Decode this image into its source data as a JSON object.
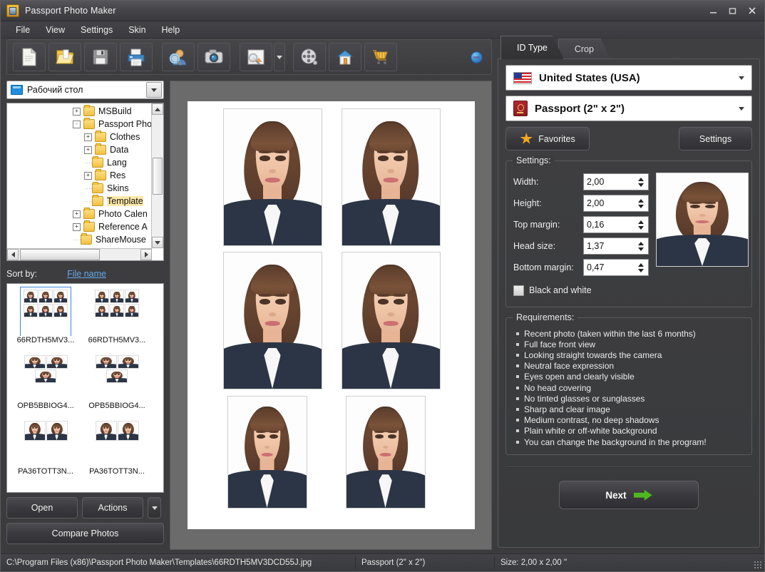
{
  "window": {
    "title": "Passport Photo Maker",
    "controls": {
      "minimize": "–",
      "maximize": "□",
      "close": "✕"
    }
  },
  "menu": {
    "items": [
      "File",
      "View",
      "Settings",
      "Skin",
      "Help"
    ]
  },
  "toolbar": {
    "buttons": [
      {
        "name": "new-document-icon",
        "tooltip": "New"
      },
      {
        "name": "open-folder-icon",
        "tooltip": "Open"
      },
      {
        "name": "save-floppy-icon",
        "tooltip": "Save"
      },
      {
        "name": "print-icon",
        "tooltip": "Print"
      },
      {
        "name": "find-person-icon",
        "tooltip": "Find person"
      },
      {
        "name": "camera-icon",
        "tooltip": "Capture from camera"
      },
      {
        "name": "image-search-icon",
        "tooltip": "Preview"
      },
      {
        "name": "film-reel-icon",
        "tooltip": "Video"
      },
      {
        "name": "home-icon",
        "tooltip": "Home page"
      },
      {
        "name": "shopping-cart-icon",
        "tooltip": "Buy now"
      }
    ],
    "extra_icon": "blue-orb-icon"
  },
  "left_panel": {
    "folder_combo": {
      "value": "Рабочий стол",
      "icon": "desktop-monitor-icon"
    },
    "tree": [
      {
        "label": "MSBuild",
        "depth": 1,
        "expander": "+",
        "selected": false
      },
      {
        "label": "Passport Pho",
        "depth": 1,
        "expander": "-",
        "selected": false
      },
      {
        "label": "Clothes",
        "depth": 2,
        "expander": "+",
        "selected": false
      },
      {
        "label": "Data",
        "depth": 2,
        "expander": "+",
        "selected": false
      },
      {
        "label": "Lang",
        "depth": 2,
        "expander": "",
        "selected": false
      },
      {
        "label": "Res",
        "depth": 2,
        "expander": "+",
        "selected": false
      },
      {
        "label": "Skins",
        "depth": 2,
        "expander": "",
        "selected": false
      },
      {
        "label": "Template",
        "depth": 2,
        "expander": "",
        "selected": true
      },
      {
        "label": "Photo Calen",
        "depth": 1,
        "expander": "+",
        "selected": false
      },
      {
        "label": "Reference A",
        "depth": 1,
        "expander": "+",
        "selected": false
      },
      {
        "label": "ShareMouse",
        "depth": 1,
        "expander": "",
        "selected": false
      }
    ],
    "sort": {
      "label": "Sort by:",
      "value": "File name"
    },
    "thumbnails": [
      {
        "name": "66RDTH5MV3...",
        "layout": "grid6",
        "selected": true
      },
      {
        "name": "66RDTH5MV3...",
        "layout": "grid6",
        "selected": false
      },
      {
        "name": "OPB5BBIOG4...",
        "layout": "strip3",
        "selected": false
      },
      {
        "name": "OPB5BBIOG4...",
        "layout": "strip3",
        "selected": false
      },
      {
        "name": "PA36TOTT3N...",
        "layout": "strip2",
        "selected": false
      },
      {
        "name": "PA36TOTT3N...",
        "layout": "strip2",
        "selected": false
      }
    ],
    "buttons": {
      "open": "Open",
      "actions": "Actions",
      "compare": "Compare Photos"
    }
  },
  "preview": {
    "photo_count": 6,
    "rows": [
      {
        "count": 2,
        "size": "large"
      },
      {
        "count": 2,
        "size": "large"
      },
      {
        "count": 2,
        "size": "small"
      }
    ]
  },
  "right_panel": {
    "tabs": [
      {
        "label": "ID Type",
        "active": true
      },
      {
        "label": "Crop",
        "active": false
      }
    ],
    "country": {
      "value": "United States (USA)",
      "icon": "usa-flag-icon"
    },
    "document_type": {
      "value": "Passport (2\" x 2\")",
      "icon": "passport-book-icon"
    },
    "favorites_button": "Favorites",
    "settings_button": "Settings",
    "settings": {
      "title": "Settings:",
      "fields": [
        {
          "label": "Width:",
          "value": "2,00"
        },
        {
          "label": "Height:",
          "value": "2,00"
        },
        {
          "label": "Top margin:",
          "value": "0,16"
        },
        {
          "label": "Head size:",
          "value": "1,37"
        },
        {
          "label": "Bottom margin:",
          "value": "0,47"
        }
      ],
      "checkbox": {
        "label": "Black and white",
        "checked": false
      }
    },
    "requirements": {
      "title": "Requirements:",
      "items": [
        "Recent photo (taken within the last 6 months)",
        "Full face front view",
        "Looking straight towards the camera",
        "Neutral face expression",
        "Eyes open and clearly visible",
        "No head covering",
        "No tinted glasses or sunglasses",
        "Sharp and clear image",
        "Medium contrast, no deep shadows",
        "Plain white or off-white background",
        "You can change the background in the program!"
      ]
    },
    "next_button": {
      "label": "Next",
      "icon": "green-arrow-icon"
    }
  },
  "status_bar": {
    "path": "C:\\Program Files (x86)\\Passport Photo Maker\\Templates\\66RDTH5MV3DCD55J.jpg",
    "doc_type": "Passport (2\" x 2\")",
    "size": "Size: 2,00 x 2,00 ''"
  },
  "colors": {
    "window_bg": "#3d3d3d",
    "panel_bg": "#3c3c3f",
    "accent_blue": "#63a8e8",
    "accent_orange": "#f5a623",
    "accent_green": "#4fb81f",
    "selection": "#fde9a9"
  }
}
